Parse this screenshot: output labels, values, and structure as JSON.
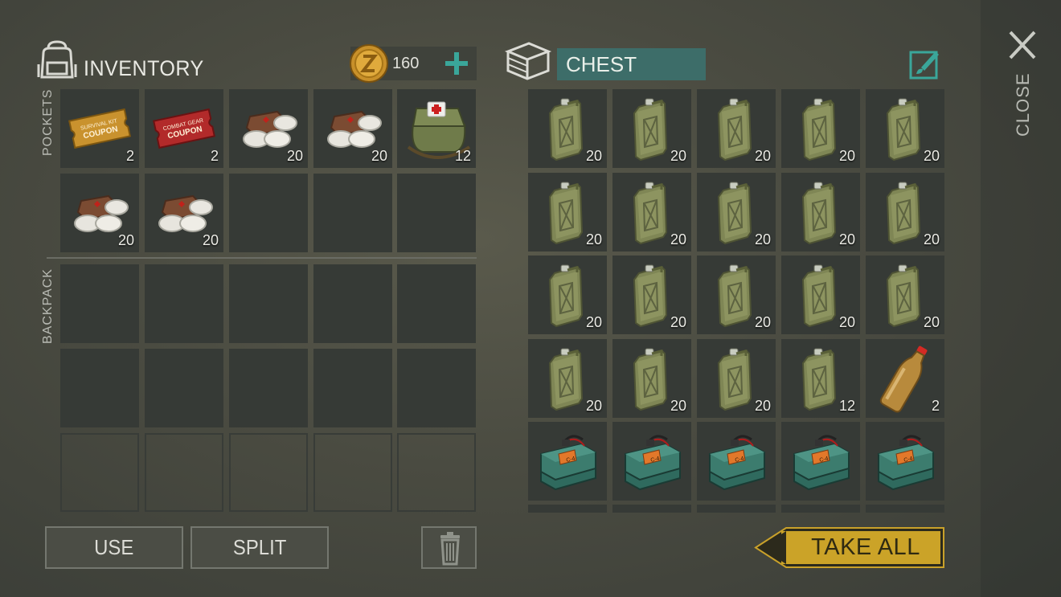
{
  "inventory": {
    "title": "INVENTORY",
    "coins": "160",
    "pockets_label": "POCKETS",
    "backpack_label": "BACKPACK",
    "pockets": [
      {
        "item": "survival-kit-coupon",
        "qty": "2"
      },
      {
        "item": "combat-gear-coupon",
        "qty": "2"
      },
      {
        "item": "bandage",
        "qty": "20"
      },
      {
        "item": "bandage",
        "qty": "20"
      },
      {
        "item": "first-aid-kit",
        "qty": "12"
      },
      {
        "item": "bandage",
        "qty": "20"
      },
      {
        "item": "bandage",
        "qty": "20"
      }
    ],
    "coupons": {
      "survival_kit": [
        "SURVIVAL KIT",
        "COUPON"
      ],
      "combat_gear": [
        "COMBAT GEAR",
        "COUPON"
      ]
    }
  },
  "chest": {
    "title": "CHEST",
    "items": [
      {
        "item": "jerrycan",
        "qty": "20"
      },
      {
        "item": "jerrycan",
        "qty": "20"
      },
      {
        "item": "jerrycan",
        "qty": "20"
      },
      {
        "item": "jerrycan",
        "qty": "20"
      },
      {
        "item": "jerrycan",
        "qty": "20"
      },
      {
        "item": "jerrycan",
        "qty": "20"
      },
      {
        "item": "jerrycan",
        "qty": "20"
      },
      {
        "item": "jerrycan",
        "qty": "20"
      },
      {
        "item": "jerrycan",
        "qty": "20"
      },
      {
        "item": "jerrycan",
        "qty": "20"
      },
      {
        "item": "jerrycan",
        "qty": "20"
      },
      {
        "item": "jerrycan",
        "qty": "20"
      },
      {
        "item": "jerrycan",
        "qty": "20"
      },
      {
        "item": "jerrycan",
        "qty": "20"
      },
      {
        "item": "jerrycan",
        "qty": "20"
      },
      {
        "item": "jerrycan",
        "qty": "20"
      },
      {
        "item": "jerrycan",
        "qty": "20"
      },
      {
        "item": "jerrycan",
        "qty": "20"
      },
      {
        "item": "jerrycan",
        "qty": "12"
      },
      {
        "item": "bottle",
        "qty": "2"
      },
      {
        "item": "c4",
        "qty": ""
      },
      {
        "item": "c4",
        "qty": ""
      },
      {
        "item": "c4",
        "qty": ""
      },
      {
        "item": "c4",
        "qty": ""
      },
      {
        "item": "c4",
        "qty": ""
      }
    ],
    "c4_label": "C-4"
  },
  "buttons": {
    "use": "USE",
    "split": "SPLIT",
    "take_all": "TAKE ALL",
    "close": "CLOSE"
  },
  "colors": {
    "accent_teal": "#3d9a93",
    "take_all_gold": "#cda52a",
    "slot_bg": "#363a36"
  }
}
